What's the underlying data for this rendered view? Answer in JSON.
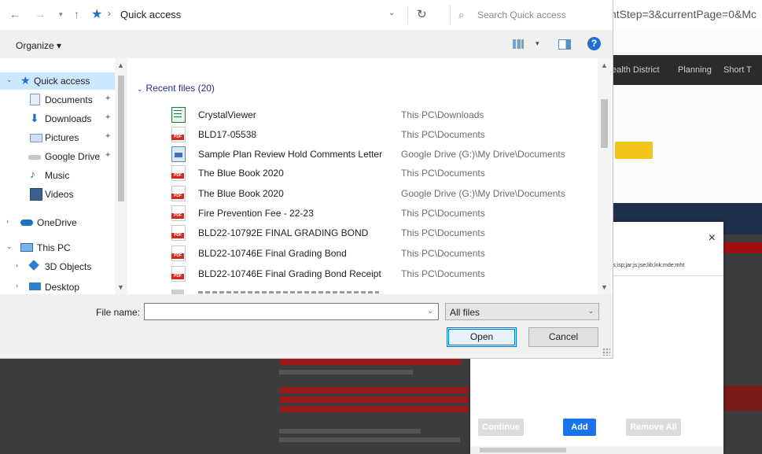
{
  "browser": {
    "url_fragment": "ntStep=3&currentPage=0&Mc",
    "nav_items": [
      "ealth District",
      "Planning",
      "Short T"
    ]
  },
  "modal": {
    "close_glyph": "×",
    "extensions_text": "ht;ins;isp;jar;js;jse;lib;lnk;mde;mht",
    "continue_label": "Continue",
    "add_label": "Add",
    "remove_all_label": "Remove All"
  },
  "dialog": {
    "breadcrumb": "Quick access",
    "search_placeholder": "Search Quick access",
    "organize_label": "Organize ▾",
    "help_glyph": "?",
    "nav": [
      {
        "label": "Quick access",
        "pinned": false
      },
      {
        "label": "Documents",
        "pinned": true
      },
      {
        "label": "Downloads",
        "pinned": true
      },
      {
        "label": "Pictures",
        "pinned": true
      },
      {
        "label": "Google Drive",
        "pinned": true
      },
      {
        "label": "Music",
        "pinned": false
      },
      {
        "label": "Videos",
        "pinned": false
      },
      {
        "label": "OneDrive",
        "pinned": false
      },
      {
        "label": "This PC",
        "pinned": false
      },
      {
        "label": "3D Objects",
        "pinned": false
      },
      {
        "label": "Desktop",
        "pinned": false
      }
    ],
    "group_header": "Recent files (20)",
    "files": [
      {
        "name": "CrystalViewer",
        "location": "This PC\\Downloads",
        "icon": "spreadsheet-icon"
      },
      {
        "name": "BLD17-05538",
        "location": "This PC\\Documents",
        "icon": "pdf-icon"
      },
      {
        "name": "Sample Plan Review Hold Comments Letter",
        "location": "Google Drive (G:)\\My Drive\\Documents",
        "icon": "image-file-icon"
      },
      {
        "name": "The Blue Book 2020",
        "location": "This PC\\Documents",
        "icon": "pdf-icon"
      },
      {
        "name": "The Blue Book 2020",
        "location": "Google Drive (G:)\\My Drive\\Documents",
        "icon": "pdf-icon"
      },
      {
        "name": "Fire Prevention Fee - 22-23",
        "location": "This PC\\Documents",
        "icon": "pdf-icon"
      },
      {
        "name": "BLD22-10792E FINAL GRADING BOND",
        "location": "This PC\\Documents",
        "icon": "pdf-icon"
      },
      {
        "name": "BLD22-10746E Final Grading Bond",
        "location": "This PC\\Documents",
        "icon": "pdf-icon"
      },
      {
        "name": "BLD22-10746E Final Grading Bond Receipt",
        "location": "This PC\\Documents",
        "icon": "pdf-icon"
      }
    ],
    "file_name_label": "File name:",
    "file_name_value": "",
    "file_type": "All files",
    "open_label": "Open",
    "cancel_label": "Cancel",
    "colors": {
      "accent": "#0078d7",
      "selection": "#cce8ff",
      "group_header": "#1e3287"
    }
  }
}
